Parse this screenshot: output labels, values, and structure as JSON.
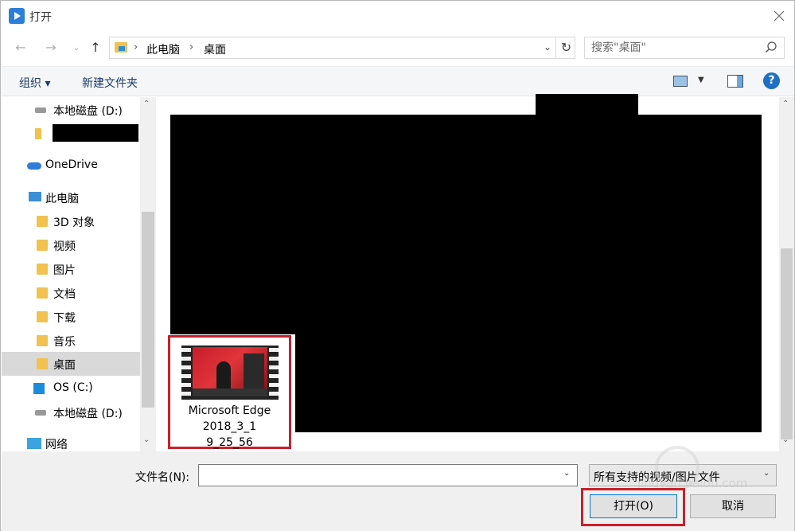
{
  "window": {
    "title": "打开"
  },
  "address": {
    "crumbs": [
      "此电脑",
      "桌面"
    ]
  },
  "search": {
    "placeholder": "搜索\"桌面\""
  },
  "toolbar": {
    "organize": "组织 ▾",
    "new_folder": "新建文件夹",
    "help": "?"
  },
  "nav": {
    "items": [
      {
        "label": "本地磁盘 (D:)",
        "icon": "drive-icon"
      },
      {
        "label": "",
        "icon": "folder-icon"
      },
      {
        "label": "OneDrive",
        "icon": "cloud-icon"
      },
      {
        "label": "此电脑",
        "icon": "computer-icon"
      },
      {
        "label": "3D 对象",
        "icon": "folder-icon"
      },
      {
        "label": "视频",
        "icon": "video-folder-icon"
      },
      {
        "label": "图片",
        "icon": "pictures-folder-icon"
      },
      {
        "label": "文档",
        "icon": "documents-folder-icon"
      },
      {
        "label": "下载",
        "icon": "downloads-folder-icon"
      },
      {
        "label": "音乐",
        "icon": "music-folder-icon"
      },
      {
        "label": "桌面",
        "icon": "desktop-folder-icon"
      },
      {
        "label": "OS (C:)",
        "icon": "windows-drive-icon"
      },
      {
        "label": "本地磁盘 (D:)",
        "icon": "drive-icon"
      },
      {
        "label": "网络",
        "icon": "network-icon"
      }
    ],
    "selected_index": 10
  },
  "files": [
    {
      "name_lines": [
        "Microsoft Edge",
        "2018_3_1",
        "9_25_56"
      ],
      "icon": "video-thumbnail-icon"
    }
  ],
  "footer": {
    "filename_label": "文件名(N):",
    "filename_value": "",
    "filetype_value": "所有支持的视频/图片文件",
    "open_label": "打开(O)",
    "cancel_label": "取消"
  },
  "watermark": {
    "text": "jingyan.baidu.com"
  },
  "colors": {
    "highlight": "#c8202b",
    "accent": "#0078d7"
  }
}
